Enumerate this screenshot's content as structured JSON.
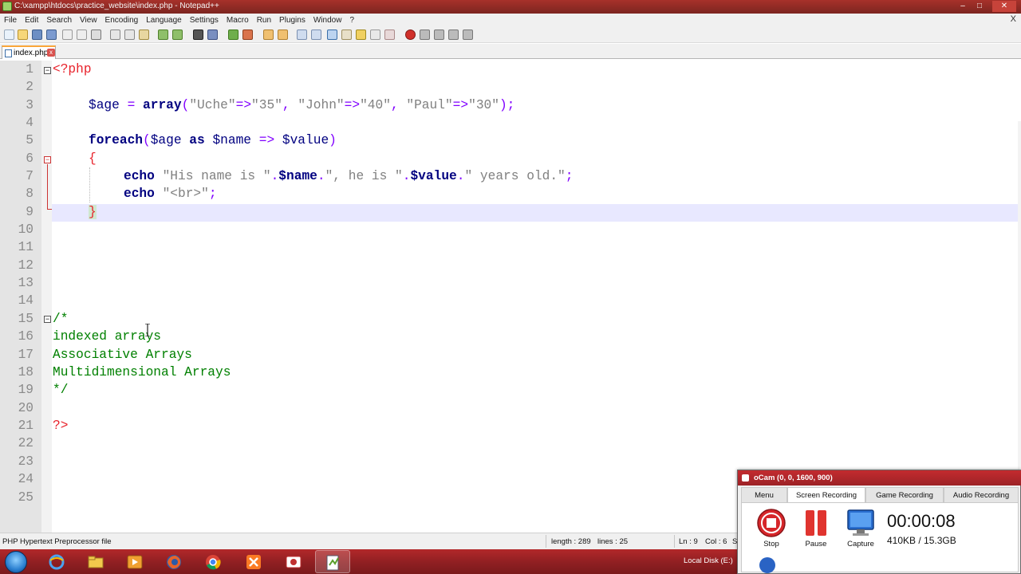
{
  "window": {
    "title": "C:\\xampp\\htdocs\\practice_website\\index.php - Notepad++",
    "min": "–",
    "max": "□",
    "close": "✕"
  },
  "menu": [
    "File",
    "Edit",
    "Search",
    "View",
    "Encoding",
    "Language",
    "Settings",
    "Macro",
    "Run",
    "Plugins",
    "Window",
    "?"
  ],
  "menu_close": "X",
  "tab": {
    "label": "index.php",
    "close": "x"
  },
  "editor": {
    "active_line": 9,
    "lines": [
      {
        "n": "1"
      },
      {
        "n": "2"
      },
      {
        "n": "3"
      },
      {
        "n": "4"
      },
      {
        "n": "5"
      },
      {
        "n": "6"
      },
      {
        "n": "7"
      },
      {
        "n": "8"
      },
      {
        "n": "9"
      },
      {
        "n": "10"
      },
      {
        "n": "11"
      },
      {
        "n": "12"
      },
      {
        "n": "13"
      },
      {
        "n": "14"
      },
      {
        "n": "15"
      },
      {
        "n": "16"
      },
      {
        "n": "17"
      },
      {
        "n": "18"
      },
      {
        "n": "19"
      },
      {
        "n": "20"
      },
      {
        "n": "21"
      },
      {
        "n": "22"
      },
      {
        "n": "23"
      },
      {
        "n": "24"
      },
      {
        "n": "25"
      }
    ],
    "code": {
      "l1": "<?php",
      "l3_var": "$age",
      "l3_eq": " = ",
      "l3_fn": "array",
      "l3_open": "(",
      "l3_s1": "\"Uche\"",
      "l3_a1": "=>",
      "l3_v1": "\"35\"",
      "l3_c1": ", ",
      "l3_s2": "\"John\"",
      "l3_a2": "=>",
      "l3_v2": "\"40\"",
      "l3_c2": ", ",
      "l3_s3": "\"Paul\"",
      "l3_a3": "=>",
      "l3_v3": "\"30\"",
      "l3_close": ");",
      "l5_kw": "foreach",
      "l5_open": "(",
      "l5_var1": "$age",
      "l5_as": " as ",
      "l5_var2": "$name",
      "l5_arrow": " => ",
      "l5_var3": "$value",
      "l5_close": ")",
      "l6": "{",
      "l7_kw": "echo",
      "l7_s1": "\"His name is \"",
      "l7_d1": ".",
      "l7_var1": "$name",
      "l7_d2": ".",
      "l7_s2": "\", he is \"",
      "l7_d3": ".",
      "l7_var2": "$value",
      "l7_d4": ".",
      "l7_s3": "\" years old.\"",
      "l7_end": ";",
      "l8_kw": "echo",
      "l8_s": "\"<br>\"",
      "l8_end": ";",
      "l9": "}",
      "l15": "/*",
      "l16": "indexed arrays",
      "l17": "Associative Arrays",
      "l18": "Multidimensional Arrays",
      "l19": "*/",
      "l21": "?>"
    }
  },
  "status": {
    "filetype": "PHP Hypertext Preprocessor file",
    "length": "length : 289",
    "lines": "lines : 25",
    "ln": "Ln : 9",
    "col": "Col : 6",
    "sel": "S"
  },
  "taskbar": {
    "tray_text": "Local Disk (E:)",
    "apps": [
      "start",
      "internet-explorer",
      "file-explorer",
      "media-player",
      "firefox",
      "chrome",
      "xampp",
      "ocam",
      "notepad-plus-plus"
    ]
  },
  "ocam": {
    "title": "oCam (0, 0, 1600, 900)",
    "tabs": [
      "Menu",
      "Screen Recording",
      "Game Recording",
      "Audio Recording"
    ],
    "stop": "Stop",
    "pause": "Pause",
    "capture": "Capture",
    "timer": "00:00:08",
    "size": "410KB / 15.3GB"
  },
  "colors": {
    "titlebar": "#9a2c26",
    "php_tag": "#e8232c",
    "keyword": "#000080",
    "operator": "#8000ff",
    "string": "#808080",
    "comment": "#008000",
    "active_line": "#e8e8ff"
  }
}
